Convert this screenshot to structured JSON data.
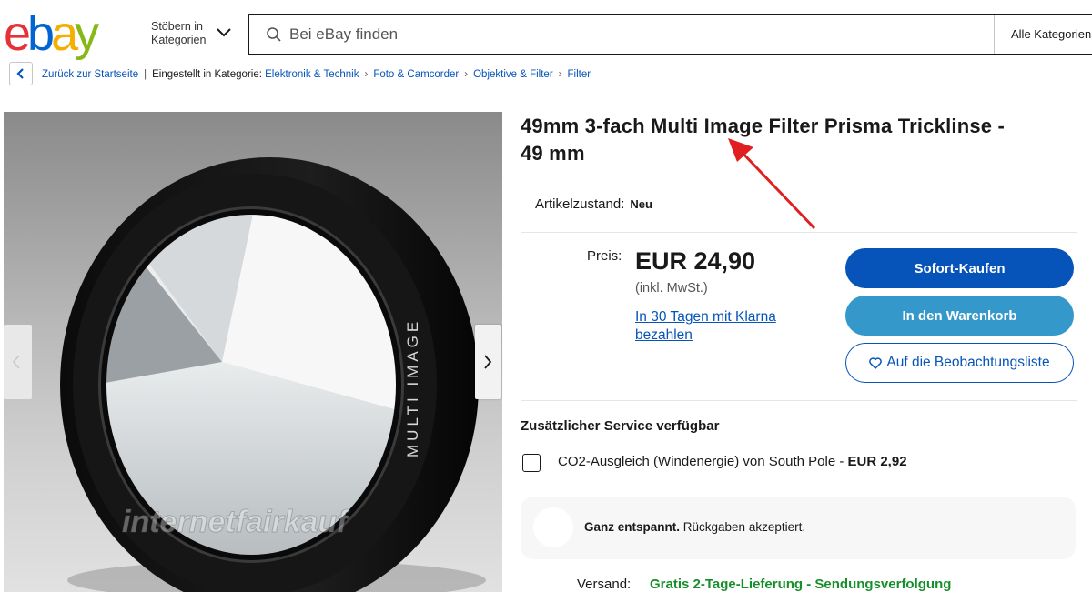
{
  "header": {
    "logo_letters": [
      "e",
      "b",
      "a",
      "y"
    ],
    "logo_colors": [
      "#e53238",
      "#0064d2",
      "#f5af02",
      "#86b817"
    ],
    "browse_line1": "Stöbern in",
    "browse_line2": "Kategorien",
    "search_placeholder": "Bei eBay finden",
    "category_select": "Alle Kategorien"
  },
  "breadcrumb": {
    "back_label": "Zurück zur Startseite",
    "listed_in": "Eingestellt in Kategorie:",
    "items": [
      "Elektronik & Technik",
      "Foto & Camcorder",
      "Objektive & Filter",
      "Filter"
    ]
  },
  "gallery": {
    "lens_ring_text": "MULTI IMAGE",
    "watermark": "internetfairkauf"
  },
  "product": {
    "title_line1": "49mm 3-fach Multi Image Filter Prisma Tricklinse -",
    "title_line2": "49 mm",
    "condition_label": "Artikelzustand:",
    "condition_value": "Neu",
    "price_label": "Preis:",
    "price": "EUR 24,90",
    "tax_note": "(inkl. MwSt.)",
    "klarna_line1": "In 30 Tagen mit Klarna",
    "klarna_line2": "bezahlen"
  },
  "actions": {
    "buy_now": "Sofort-Kaufen",
    "add_to_cart": "In den Warenkorb",
    "watchlist": "Auf die Beobachtungsliste"
  },
  "service": {
    "title": "Zusätzlicher Service verfügbar",
    "option_link": "CO2-Ausgleich (Windenergie) von South Pole ",
    "option_sep": "- ",
    "option_price": "EUR 2,92"
  },
  "returns": {
    "bold": "Ganz entspannt.",
    "text": " Rückgaben akzeptiert."
  },
  "shipping": {
    "label": "Versand:",
    "value": "Gratis 2-Tage-Lieferung - Sendungsverfolgung"
  },
  "colors": {
    "link_blue": "#0654ba",
    "cart_blue": "#3498ca",
    "shipping_green": "#168f2a",
    "annotation_red": "#e02020"
  }
}
